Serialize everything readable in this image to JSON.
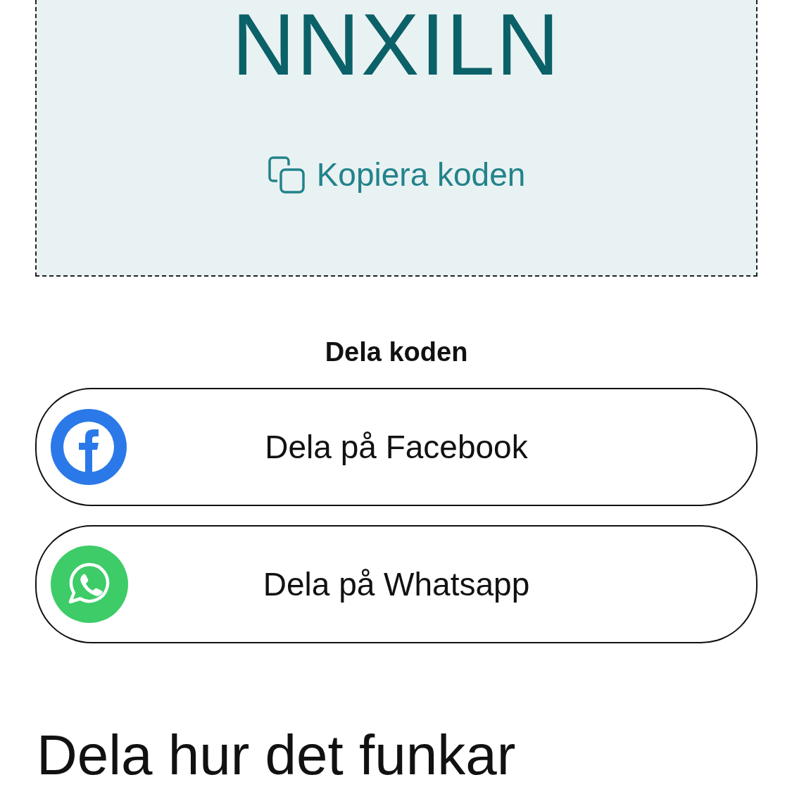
{
  "coupon": {
    "code": "NNXILN",
    "copy_label": "Kopiera koden"
  },
  "share": {
    "title": "Dela koden",
    "buttons": [
      {
        "kind": "facebook",
        "label": "Dela på Facebook"
      },
      {
        "kind": "whatsapp",
        "label": "Dela på Whatsapp"
      }
    ]
  },
  "how_it_works": {
    "heading": "Dela hur det funkar"
  }
}
